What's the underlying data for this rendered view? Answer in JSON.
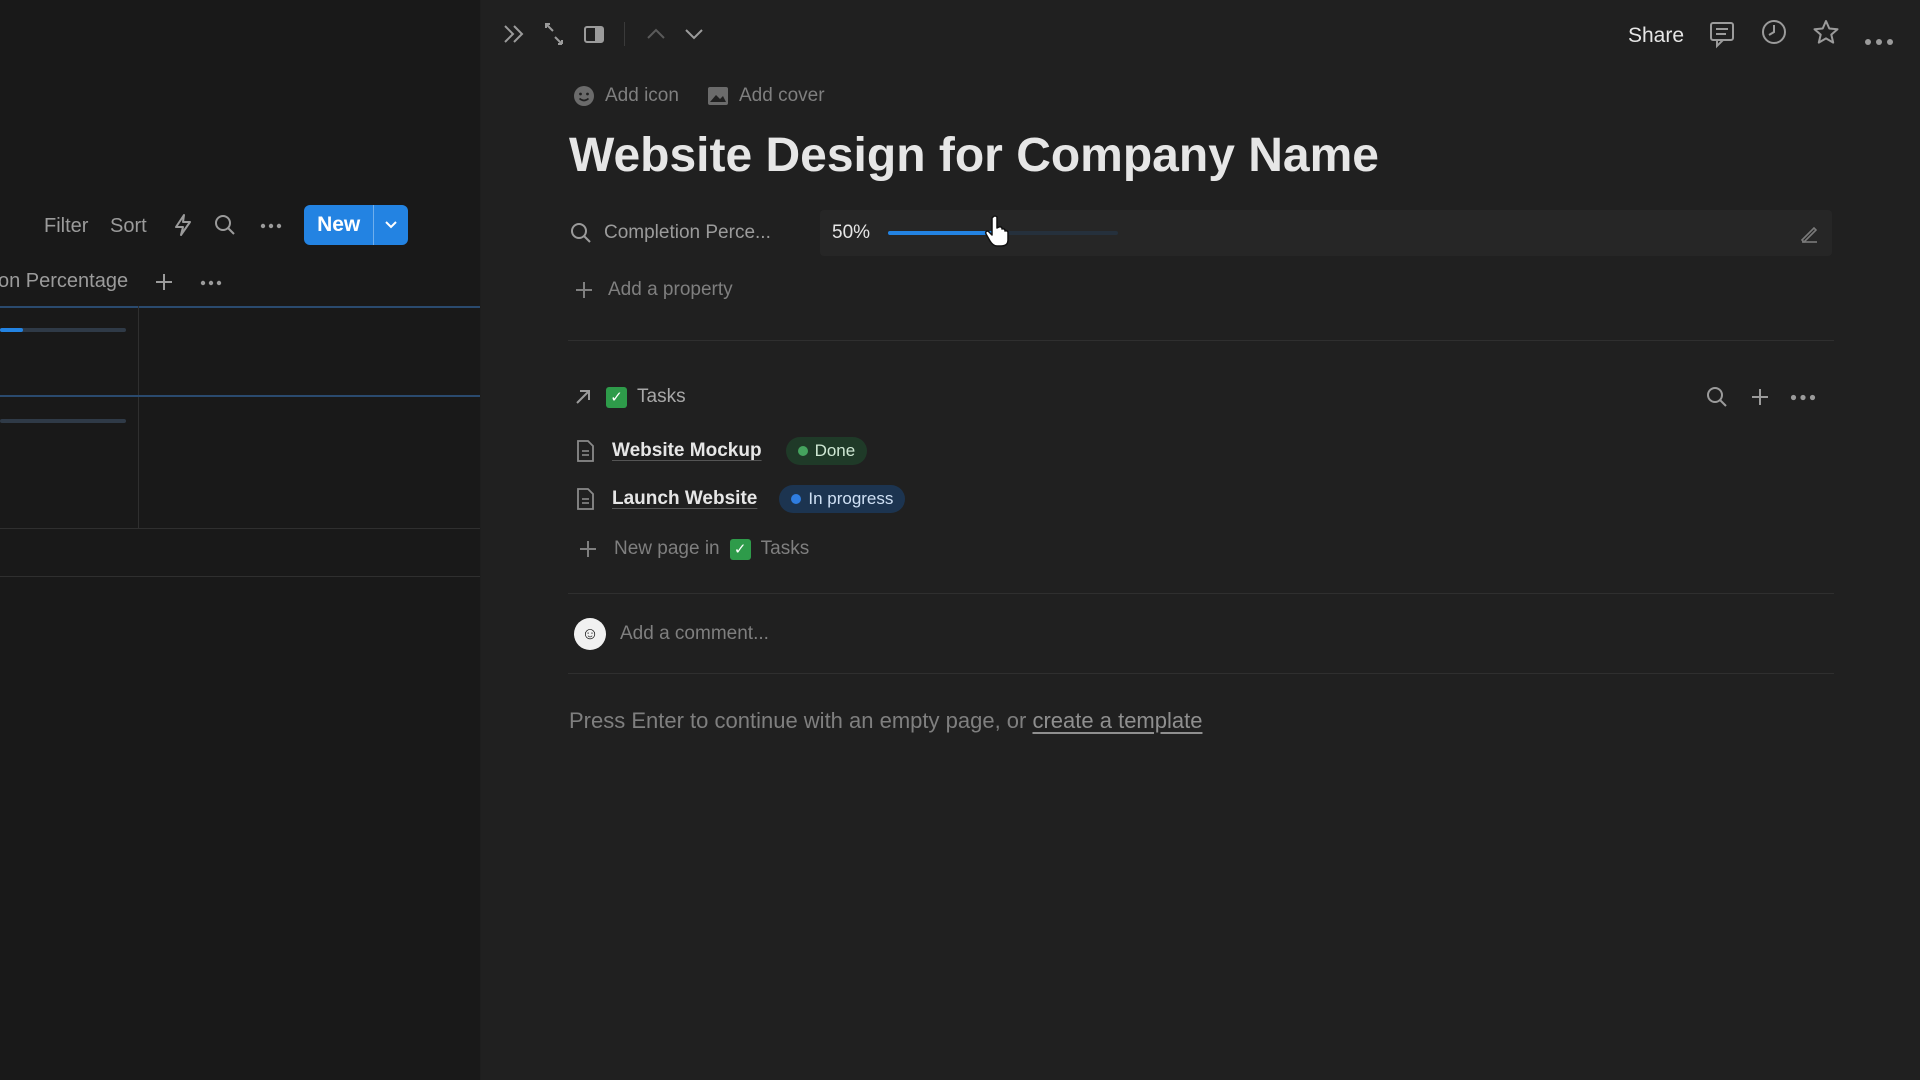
{
  "left_pane": {
    "toolbar": {
      "filter_label": "Filter",
      "sort_label": "Sort",
      "new_label": "New"
    },
    "table": {
      "column_header": "on Percentage",
      "rows": [
        {
          "completion_fraction": 0.18
        },
        {
          "completion_fraction": 0.0
        }
      ]
    }
  },
  "topbar": {
    "share_label": "Share"
  },
  "page": {
    "add_icon_label": "Add icon",
    "add_cover_label": "Add cover",
    "title": "Website Design for Company Name",
    "property": {
      "name": "Completion Perce...",
      "value_text": "50%",
      "value_fraction": 0.5
    },
    "add_property_label": "Add a property",
    "relation": {
      "label": "Tasks",
      "items": [
        {
          "name": "Website Mockup",
          "status": "Done",
          "status_color": "#45a35e",
          "badge_bg": "#1f3a28",
          "badge_text": "#cfe8d4"
        },
        {
          "name": "Launch Website",
          "status": "In progress",
          "status_color": "#2f7de0",
          "badge_bg": "#1c3450",
          "badge_text": "#cfe0f4"
        }
      ],
      "new_page_label": "New page in",
      "new_page_target": "Tasks"
    },
    "comment_placeholder": "Add a comment...",
    "empty_hint": "Press Enter to continue with an empty page, or ",
    "template_link": "create a template"
  },
  "colors": {
    "accent": "#2383e2",
    "background": "#191919",
    "panel": "#202020"
  }
}
